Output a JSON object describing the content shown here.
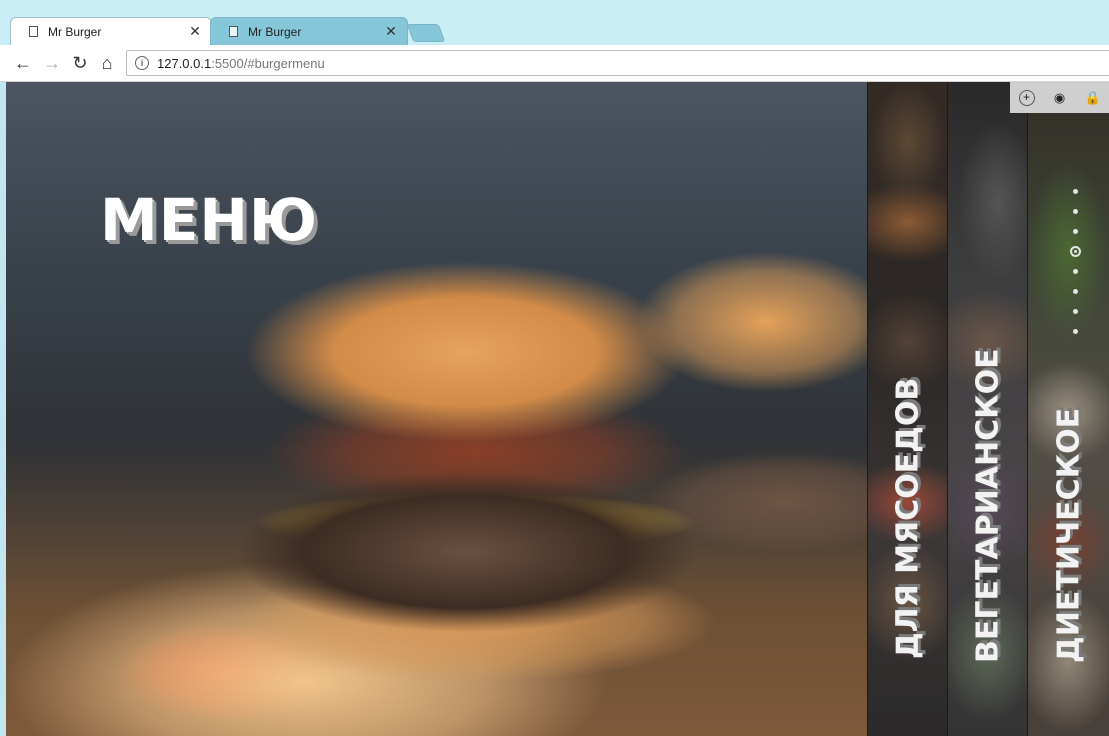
{
  "browser": {
    "tabs": [
      {
        "title": "Mr Burger",
        "active": true,
        "close": "✕"
      },
      {
        "title": "Mr Burger",
        "active": false,
        "close": "✕"
      }
    ],
    "nav": {
      "back_icon": "←",
      "forward_icon": "→",
      "reload_icon": "↻",
      "home_icon": "⌂"
    },
    "url": {
      "host": "127.0.0.1",
      "rest": ":5500/#burgermenu",
      "info_icon": "i"
    }
  },
  "page": {
    "title": "МЕНЮ",
    "sections": [
      {
        "label": "ДЛЯ МЯСОЕДОВ"
      },
      {
        "label": "ВЕГЕТАРИАНСКОЕ"
      },
      {
        "label": "ДИЕТИЧЕСКОЕ"
      }
    ],
    "pager": {
      "count": 8,
      "active_index": 4
    }
  },
  "ext_toolbar": {
    "icons": [
      "plus-icon",
      "eye-icon",
      "lock-icon"
    ],
    "glyphs": [
      "+",
      "◉",
      "🔒"
    ]
  },
  "colors": {
    "tab_strip": "#c9eef5",
    "inactive_tab": "#86c6d9",
    "title_text": "#ffffff"
  }
}
